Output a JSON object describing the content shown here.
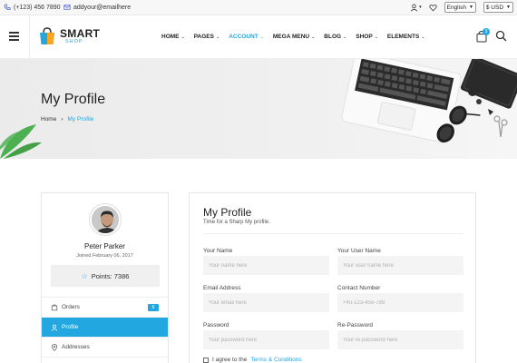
{
  "topbar": {
    "phone": "(+123) 456 7890",
    "email": "addyour@emailhere",
    "language": "English",
    "currency": "$ USD"
  },
  "header": {
    "logo_title": "SMART",
    "logo_sub": "SHOP",
    "nav": [
      {
        "label": "HOME",
        "active": false
      },
      {
        "label": "PAGES",
        "active": false
      },
      {
        "label": "ACCOUNT",
        "active": true
      },
      {
        "label": "MEGA MENU",
        "active": false
      },
      {
        "label": "BLOG",
        "active": false
      },
      {
        "label": "SHOP",
        "active": false
      },
      {
        "label": "ELEMENTS",
        "active": false
      }
    ],
    "cart_count": "3"
  },
  "hero": {
    "title": "My Profile",
    "breadcrumb_home": "Home",
    "breadcrumb_sep": "›",
    "breadcrumb_current": "My Profile"
  },
  "sidebar": {
    "name": "Peter Parker",
    "joined": "Joined February 06, 2017",
    "points": "Points: 7386",
    "menu": [
      {
        "label": "Orders",
        "icon": "orders-icon",
        "count": "6"
      },
      {
        "label": "Profile",
        "icon": "user-icon",
        "count": ""
      },
      {
        "label": "Addresses",
        "icon": "location-icon",
        "count": ""
      },
      {
        "label": "",
        "icon": "heart-icon",
        "count": ""
      }
    ]
  },
  "profile_form": {
    "title": "My Profile",
    "subtitle": "Time for a Sharp My profile.",
    "fields": {
      "name": {
        "label": "Your Name",
        "placeholder": "Your name here"
      },
      "username": {
        "label": "Your User Name",
        "placeholder": "Your user name here"
      },
      "email": {
        "label": "Email Address",
        "placeholder": "Your email here"
      },
      "contact": {
        "label": "Contact Number",
        "placeholder": "+40-123-456-789"
      },
      "password": {
        "label": "Password",
        "placeholder": "Your password here"
      },
      "repassword": {
        "label": "Re-Password",
        "placeholder": "Your re-password here"
      }
    },
    "agree_prefix": "I agree to the",
    "agree_link": "Terms & Conditions"
  },
  "colors": {
    "accent": "#22a7e0",
    "text": "#222222"
  }
}
